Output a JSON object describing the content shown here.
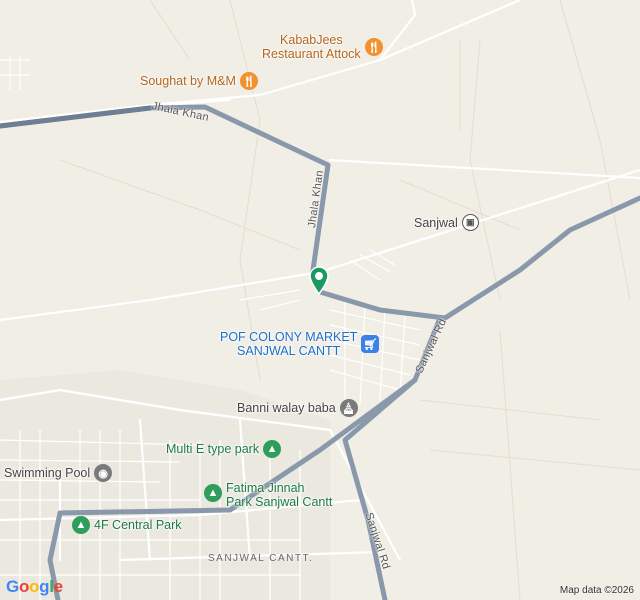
{
  "map": {
    "pois": [
      {
        "id": "kababjees",
        "lines": [
          "KababJees",
          "Restaurant Attock"
        ],
        "type": "food",
        "icon": "restaurant-icon"
      },
      {
        "id": "soughat",
        "lines": [
          "Soughat by M&M"
        ],
        "type": "food",
        "icon": "restaurant-icon"
      },
      {
        "id": "sanjwal",
        "lines": [
          "Sanjwal"
        ],
        "type": "gen",
        "icon": "transit-icon"
      },
      {
        "id": "pof-market",
        "lines": [
          "POF COLONY MARKET",
          "SANJWAL CANTT"
        ],
        "type": "shop",
        "icon": "shopping-cart-icon"
      },
      {
        "id": "banni",
        "lines": [
          "Banni walay baba"
        ],
        "type": "gen",
        "icon": "landmark-icon"
      },
      {
        "id": "multi-e",
        "lines": [
          "Multi E type park"
        ],
        "type": "park",
        "icon": "tree-icon"
      },
      {
        "id": "fatima-jinnah",
        "lines": [
          "Fatima Jinnah",
          "Park Sanjwal Cantt"
        ],
        "type": "park",
        "icon": "tree-icon"
      },
      {
        "id": "swimming-pool",
        "lines": [
          "Swimming Pool"
        ],
        "type": "gen",
        "icon": "swimming-pool-icon"
      },
      {
        "id": "central-park",
        "lines": [
          "4F Central Park"
        ],
        "type": "park",
        "icon": "tree-icon"
      }
    ],
    "roads": {
      "jhala_khan_1": "Jhala Khan",
      "jhala_khan_2": "Jhala Khan",
      "sanjwal_rd_1": "Sanjwal Rd",
      "sanjwal_rd_2": "Sanjwal Rd"
    },
    "area_label": "SANJWAL CANTT.",
    "attribution": "Map data ©2026",
    "logo": [
      "G",
      "o",
      "o",
      "g",
      "l",
      "e"
    ],
    "colors": {
      "background": "#f1eee5",
      "major_road": "#8a98ab",
      "minor_road": "#ffffff",
      "selected_pin": "#1a9a63"
    }
  }
}
